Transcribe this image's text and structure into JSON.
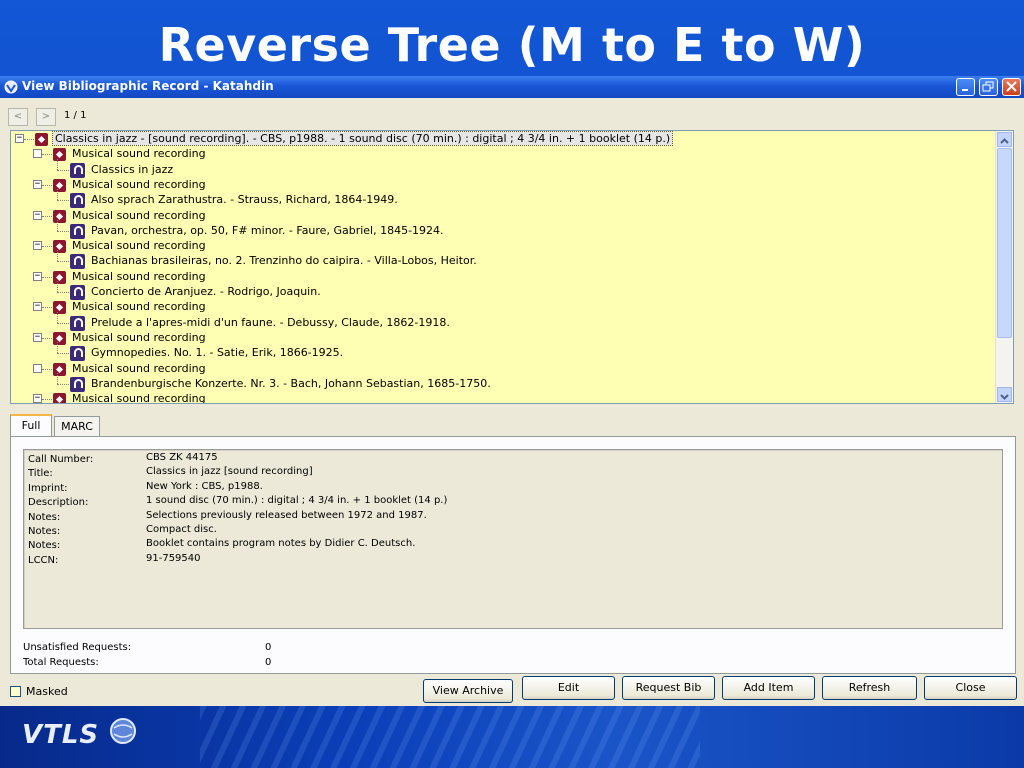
{
  "slide": {
    "title": "Reverse Tree (M to E to W)"
  },
  "window": {
    "title": "View Bibliographic Record - Katahdin"
  },
  "nav": {
    "prev": "<",
    "next": ">",
    "page": "1 / 1"
  },
  "tree": {
    "root": "Classics in jazz - [sound recording]. - CBS, p1988. - 1 sound disc (70 min.) : digital ; 4 3/4 in. + 1 booklet (14 p.)",
    "items": [
      {
        "label": "Musical sound recording",
        "child": "Classics in jazz",
        "expanded": false
      },
      {
        "label": "Musical sound recording",
        "child": "Also sprach Zarathustra. - Strauss, Richard, 1864-1949.",
        "expanded": true
      },
      {
        "label": "Musical sound recording",
        "child": "Pavan, orchestra, op. 50, F# minor. - Faure, Gabriel, 1845-1924.",
        "expanded": true
      },
      {
        "label": "Musical sound recording",
        "child": "Bachianas brasileiras, no. 2. Trenzinho do caipira. - Villa-Lobos, Heitor.",
        "expanded": true
      },
      {
        "label": "Musical sound recording",
        "child": "Concierto de Aranjuez. - Rodrigo, Joaquin.",
        "expanded": true
      },
      {
        "label": "Musical sound recording",
        "child": "Prelude a l'apres-midi d'un faune. - Debussy, Claude, 1862-1918.",
        "expanded": true
      },
      {
        "label": "Musical sound recording",
        "child": "Gymnopedies. No. 1. - Satie, Erik, 1866-1925.",
        "expanded": true
      },
      {
        "label": "Musical sound recording",
        "child": "Brandenburgische Konzerte. Nr. 3. - Bach, Johann Sebastian, 1685-1750.",
        "expanded": false
      },
      {
        "label": "Musical sound recording",
        "child": "",
        "expanded": true
      }
    ]
  },
  "tabs": {
    "full": "Full",
    "marc": "MARC"
  },
  "record": {
    "fields": [
      {
        "label": "Call Number:",
        "value": "CBS ZK 44175"
      },
      {
        "label": "Title:",
        "value": "Classics in jazz [sound recording]"
      },
      {
        "label": "Imprint:",
        "value": "New York : CBS, p1988."
      },
      {
        "label": "Description:",
        "value": "1 sound disc (70 min.) : digital ; 4 3/4 in. + 1 booklet (14 p.)"
      },
      {
        "label": "Notes:",
        "value": "Selections previously released between 1972 and 1987."
      },
      {
        "label": "Notes:",
        "value": "Compact disc."
      },
      {
        "label": "Notes:",
        "value": "Booklet contains program notes by Didier C. Deutsch."
      },
      {
        "label": "LCCN:",
        "value": "91-759540"
      }
    ]
  },
  "stats": {
    "unsatisfied_label": "Unsatisfied Requests:",
    "unsatisfied_value": "0",
    "total_label": "Total Requests:",
    "total_value": "0"
  },
  "bottom": {
    "masked": "Masked",
    "view_archive": "View Archive",
    "edit": "Edit",
    "request_bib": "Request Bib",
    "add_item": "Add Item",
    "refresh": "Refresh",
    "close": "Close"
  },
  "footer": {
    "logo": "VTLS"
  },
  "colors": {
    "tree_bg": "#ffffb3",
    "titlebar": "#1a56d6",
    "slide_bg": "#0f4fc4"
  }
}
